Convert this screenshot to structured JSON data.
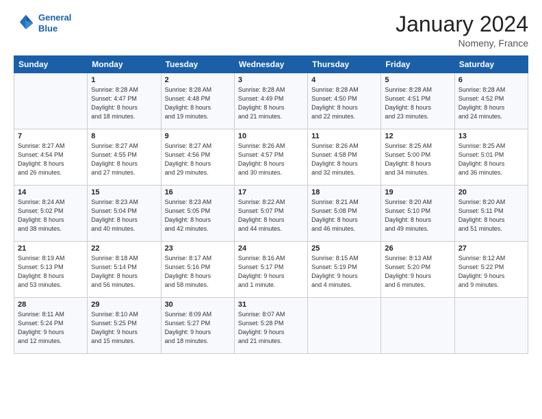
{
  "header": {
    "logo_line1": "General",
    "logo_line2": "Blue",
    "month": "January 2024",
    "location": "Nomeny, France"
  },
  "columns": [
    "Sunday",
    "Monday",
    "Tuesday",
    "Wednesday",
    "Thursday",
    "Friday",
    "Saturday"
  ],
  "weeks": [
    [
      {
        "day": "",
        "content": ""
      },
      {
        "day": "1",
        "content": "Sunrise: 8:28 AM\nSunset: 4:47 PM\nDaylight: 8 hours\nand 18 minutes."
      },
      {
        "day": "2",
        "content": "Sunrise: 8:28 AM\nSunset: 4:48 PM\nDaylight: 8 hours\nand 19 minutes."
      },
      {
        "day": "3",
        "content": "Sunrise: 8:28 AM\nSunset: 4:49 PM\nDaylight: 8 hours\nand 21 minutes."
      },
      {
        "day": "4",
        "content": "Sunrise: 8:28 AM\nSunset: 4:50 PM\nDaylight: 8 hours\nand 22 minutes."
      },
      {
        "day": "5",
        "content": "Sunrise: 8:28 AM\nSunset: 4:51 PM\nDaylight: 8 hours\nand 23 minutes."
      },
      {
        "day": "6",
        "content": "Sunrise: 8:28 AM\nSunset: 4:52 PM\nDaylight: 8 hours\nand 24 minutes."
      }
    ],
    [
      {
        "day": "7",
        "content": "Sunrise: 8:27 AM\nSunset: 4:54 PM\nDaylight: 8 hours\nand 26 minutes."
      },
      {
        "day": "8",
        "content": "Sunrise: 8:27 AM\nSunset: 4:55 PM\nDaylight: 8 hours\nand 27 minutes."
      },
      {
        "day": "9",
        "content": "Sunrise: 8:27 AM\nSunset: 4:56 PM\nDaylight: 8 hours\nand 29 minutes."
      },
      {
        "day": "10",
        "content": "Sunrise: 8:26 AM\nSunset: 4:57 PM\nDaylight: 8 hours\nand 30 minutes."
      },
      {
        "day": "11",
        "content": "Sunrise: 8:26 AM\nSunset: 4:58 PM\nDaylight: 8 hours\nand 32 minutes."
      },
      {
        "day": "12",
        "content": "Sunrise: 8:25 AM\nSunset: 5:00 PM\nDaylight: 8 hours\nand 34 minutes."
      },
      {
        "day": "13",
        "content": "Sunrise: 8:25 AM\nSunset: 5:01 PM\nDaylight: 8 hours\nand 36 minutes."
      }
    ],
    [
      {
        "day": "14",
        "content": "Sunrise: 8:24 AM\nSunset: 5:02 PM\nDaylight: 8 hours\nand 38 minutes."
      },
      {
        "day": "15",
        "content": "Sunrise: 8:23 AM\nSunset: 5:04 PM\nDaylight: 8 hours\nand 40 minutes."
      },
      {
        "day": "16",
        "content": "Sunrise: 8:23 AM\nSunset: 5:05 PM\nDaylight: 8 hours\nand 42 minutes."
      },
      {
        "day": "17",
        "content": "Sunrise: 8:22 AM\nSunset: 5:07 PM\nDaylight: 8 hours\nand 44 minutes."
      },
      {
        "day": "18",
        "content": "Sunrise: 8:21 AM\nSunset: 5:08 PM\nDaylight: 8 hours\nand 46 minutes."
      },
      {
        "day": "19",
        "content": "Sunrise: 8:20 AM\nSunset: 5:10 PM\nDaylight: 8 hours\nand 49 minutes."
      },
      {
        "day": "20",
        "content": "Sunrise: 8:20 AM\nSunset: 5:11 PM\nDaylight: 8 hours\nand 51 minutes."
      }
    ],
    [
      {
        "day": "21",
        "content": "Sunrise: 8:19 AM\nSunset: 5:13 PM\nDaylight: 8 hours\nand 53 minutes."
      },
      {
        "day": "22",
        "content": "Sunrise: 8:18 AM\nSunset: 5:14 PM\nDaylight: 8 hours\nand 56 minutes."
      },
      {
        "day": "23",
        "content": "Sunrise: 8:17 AM\nSunset: 5:16 PM\nDaylight: 8 hours\nand 58 minutes."
      },
      {
        "day": "24",
        "content": "Sunrise: 8:16 AM\nSunset: 5:17 PM\nDaylight: 9 hours\nand 1 minute."
      },
      {
        "day": "25",
        "content": "Sunrise: 8:15 AM\nSunset: 5:19 PM\nDaylight: 9 hours\nand 4 minutes."
      },
      {
        "day": "26",
        "content": "Sunrise: 8:13 AM\nSunset: 5:20 PM\nDaylight: 9 hours\nand 6 minutes."
      },
      {
        "day": "27",
        "content": "Sunrise: 8:12 AM\nSunset: 5:22 PM\nDaylight: 9 hours\nand 9 minutes."
      }
    ],
    [
      {
        "day": "28",
        "content": "Sunrise: 8:11 AM\nSunset: 5:24 PM\nDaylight: 9 hours\nand 12 minutes."
      },
      {
        "day": "29",
        "content": "Sunrise: 8:10 AM\nSunset: 5:25 PM\nDaylight: 9 hours\nand 15 minutes."
      },
      {
        "day": "30",
        "content": "Sunrise: 8:09 AM\nSunset: 5:27 PM\nDaylight: 9 hours\nand 18 minutes."
      },
      {
        "day": "31",
        "content": "Sunrise: 8:07 AM\nSunset: 5:28 PM\nDaylight: 9 hours\nand 21 minutes."
      },
      {
        "day": "",
        "content": ""
      },
      {
        "day": "",
        "content": ""
      },
      {
        "day": "",
        "content": ""
      }
    ]
  ]
}
